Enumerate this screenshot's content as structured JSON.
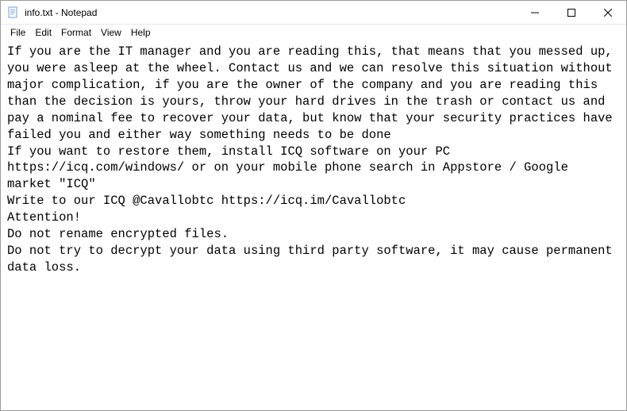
{
  "titlebar": {
    "title": "info.txt - Notepad"
  },
  "menubar": {
    "file": "File",
    "edit": "Edit",
    "format": "Format",
    "view": "View",
    "help": "Help"
  },
  "editor": {
    "content": "If you are the IT manager and you are reading this, that means that you messed up, you were asleep at the wheel. Contact us and we can resolve this situation without major complication, if you are the owner of the company and you are reading this than the decision is yours, throw your hard drives in the trash or contact us and pay a nominal fee to recover your data, but know that your security practices have failed you and either way something needs to be done\nIf you want to restore them, install ICQ software on your PC https://icq.com/windows/ or on your mobile phone search in Appstore / Google market \"ICQ\"\nWrite to our ICQ @Cavallobtc https://icq.im/Cavallobtc\nAttention!\nDo not rename encrypted files.\nDo not try to decrypt your data using third party software, it may cause permanent data loss."
  }
}
